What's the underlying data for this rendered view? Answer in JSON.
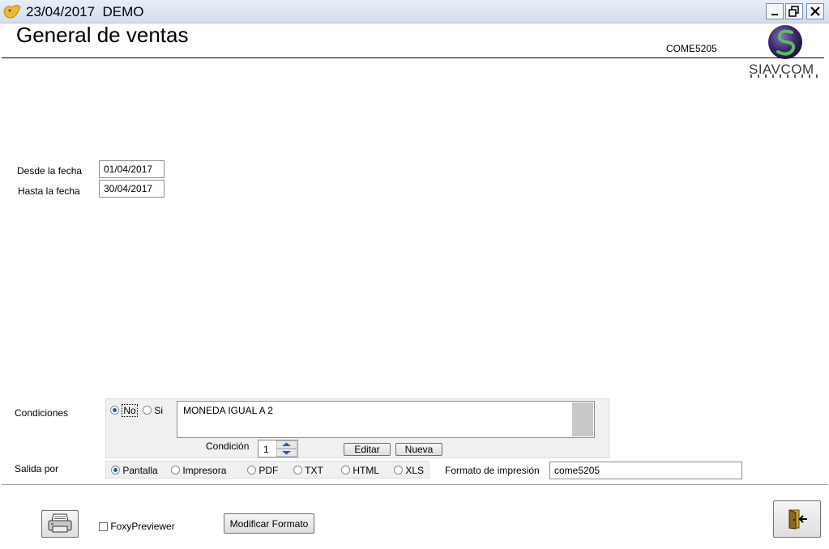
{
  "window": {
    "title": "23/04/2017  DEMO",
    "minimize_label": "_",
    "close_label": "✕"
  },
  "header": {
    "title": "General de ventas",
    "form_code": "COME5205",
    "logo_text": "SIAVCOM"
  },
  "dates": {
    "from_label": "Desde la fecha",
    "from_value": "01/04/2017",
    "to_label": "Hasta la fecha",
    "to_value": "30/04/2017"
  },
  "conditions": {
    "label": "Condiciones",
    "option_no": "No",
    "option_si": "Si",
    "selected": "No",
    "text": "MONEDA IGUAL A 2",
    "condition_label": "Condición",
    "condition_value": "1",
    "edit_button": "Editar",
    "new_button": "Nueva"
  },
  "output": {
    "label": "Salida por",
    "options": [
      "Pantalla",
      "Impresora",
      "PDF",
      "TXT",
      "HTML",
      "XLS"
    ],
    "selected": "Pantalla",
    "format_label": "Formato de impresión",
    "format_value": "come5205"
  },
  "footer": {
    "foxy_label": "FoxyPreviewer",
    "foxy_checked": false,
    "modify_button": "Modificar Formato"
  },
  "icons": {
    "app": "app-logo-icon",
    "print": "printer-icon",
    "exit": "exit-door-icon"
  },
  "colors": {
    "accent": "#1a5fb4",
    "titlebar": "#d3ddee",
    "panel": "#f0f0f0"
  }
}
